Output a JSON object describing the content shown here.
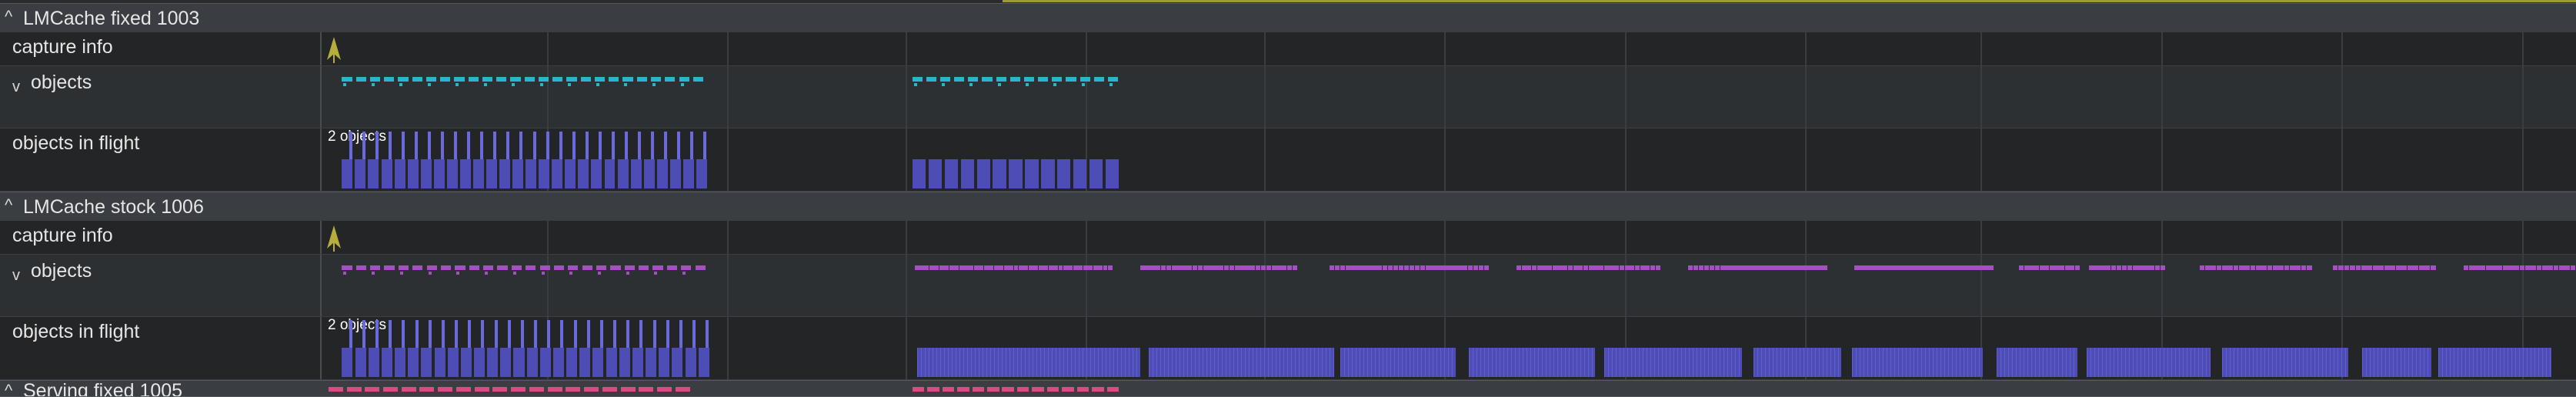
{
  "viewport": {
    "t_start": 0,
    "t_end": 1000
  },
  "grid_times": [
    100,
    180,
    259,
    339,
    418,
    498,
    578,
    658,
    736,
    816,
    896,
    976
  ],
  "colors": {
    "cyan": "#2bb5c8",
    "magenta": "#a64fc4",
    "violet_bar": "#4d4db5",
    "violet_edge": "#6a6ade",
    "pink": "#d94a86",
    "marker": "#b7ad3c"
  },
  "groups": [
    {
      "title": "LMCache fixed 1003",
      "chevron": "^",
      "tracks": [
        {
          "kind": "marker",
          "label": "capture info",
          "marker_t": 5
        },
        {
          "kind": "slices",
          "label": "objects",
          "chevron": "v",
          "color": "cyan",
          "style": "dash",
          "ranges": [
            [
              9,
              171,
              26
            ],
            [
              262,
              355,
              15
            ]
          ]
        },
        {
          "kind": "counter",
          "label": "objects in flight",
          "count_label": "2 objects",
          "ranges": [
            [
              9,
              172,
              28,
              "tall"
            ],
            [
              262,
              355,
              13,
              "short"
            ]
          ]
        }
      ]
    },
    {
      "title": "LMCache stock 1006",
      "chevron": "^",
      "tracks": [
        {
          "kind": "marker",
          "label": "capture info",
          "marker_t": 5
        },
        {
          "kind": "slices",
          "label": "objects",
          "chevron": "v",
          "color": "magenta",
          "style": "dash",
          "ranges": [
            [
              9,
              172,
              26
            ],
            [
              263,
              351,
              40
            ],
            [
              363,
              433,
              30
            ],
            [
              447,
              518,
              30
            ],
            [
              530,
              594,
              28
            ],
            [
              606,
              668,
              26
            ],
            [
              680,
              742,
              26
            ],
            [
              753,
              780,
              12
            ],
            [
              784,
              818,
              14
            ],
            [
              833,
              883,
              20
            ],
            [
              892,
              938,
              18
            ],
            [
              950,
              1000,
              20
            ]
          ],
          "dense_from": 1
        },
        {
          "kind": "counter",
          "label": "objects in flight",
          "count_label": "2 objects",
          "ranges": [
            [
              9,
              173,
              28,
              "tall"
            ],
            [
              264,
              363,
              0,
              "block"
            ],
            [
              367,
              449,
              0,
              "block"
            ],
            [
              452,
              503,
              0,
              "block"
            ],
            [
              509,
              565,
              0,
              "block"
            ],
            [
              569,
              630,
              0,
              "block"
            ],
            [
              635,
              674,
              0,
              "block"
            ],
            [
              679,
              737,
              0,
              "block"
            ],
            [
              743,
              779,
              0,
              "block"
            ],
            [
              783,
              838,
              0,
              "block"
            ],
            [
              843,
              899,
              0,
              "block"
            ],
            [
              905,
              936,
              0,
              "block"
            ],
            [
              939,
              989,
              0,
              "block"
            ]
          ]
        }
      ]
    },
    {
      "title": "Serving fixed 1005",
      "chevron": "^",
      "partial": true,
      "pink_ranges": [
        [
          3,
          165,
          20
        ],
        [
          262,
          355,
          14
        ]
      ]
    }
  ]
}
